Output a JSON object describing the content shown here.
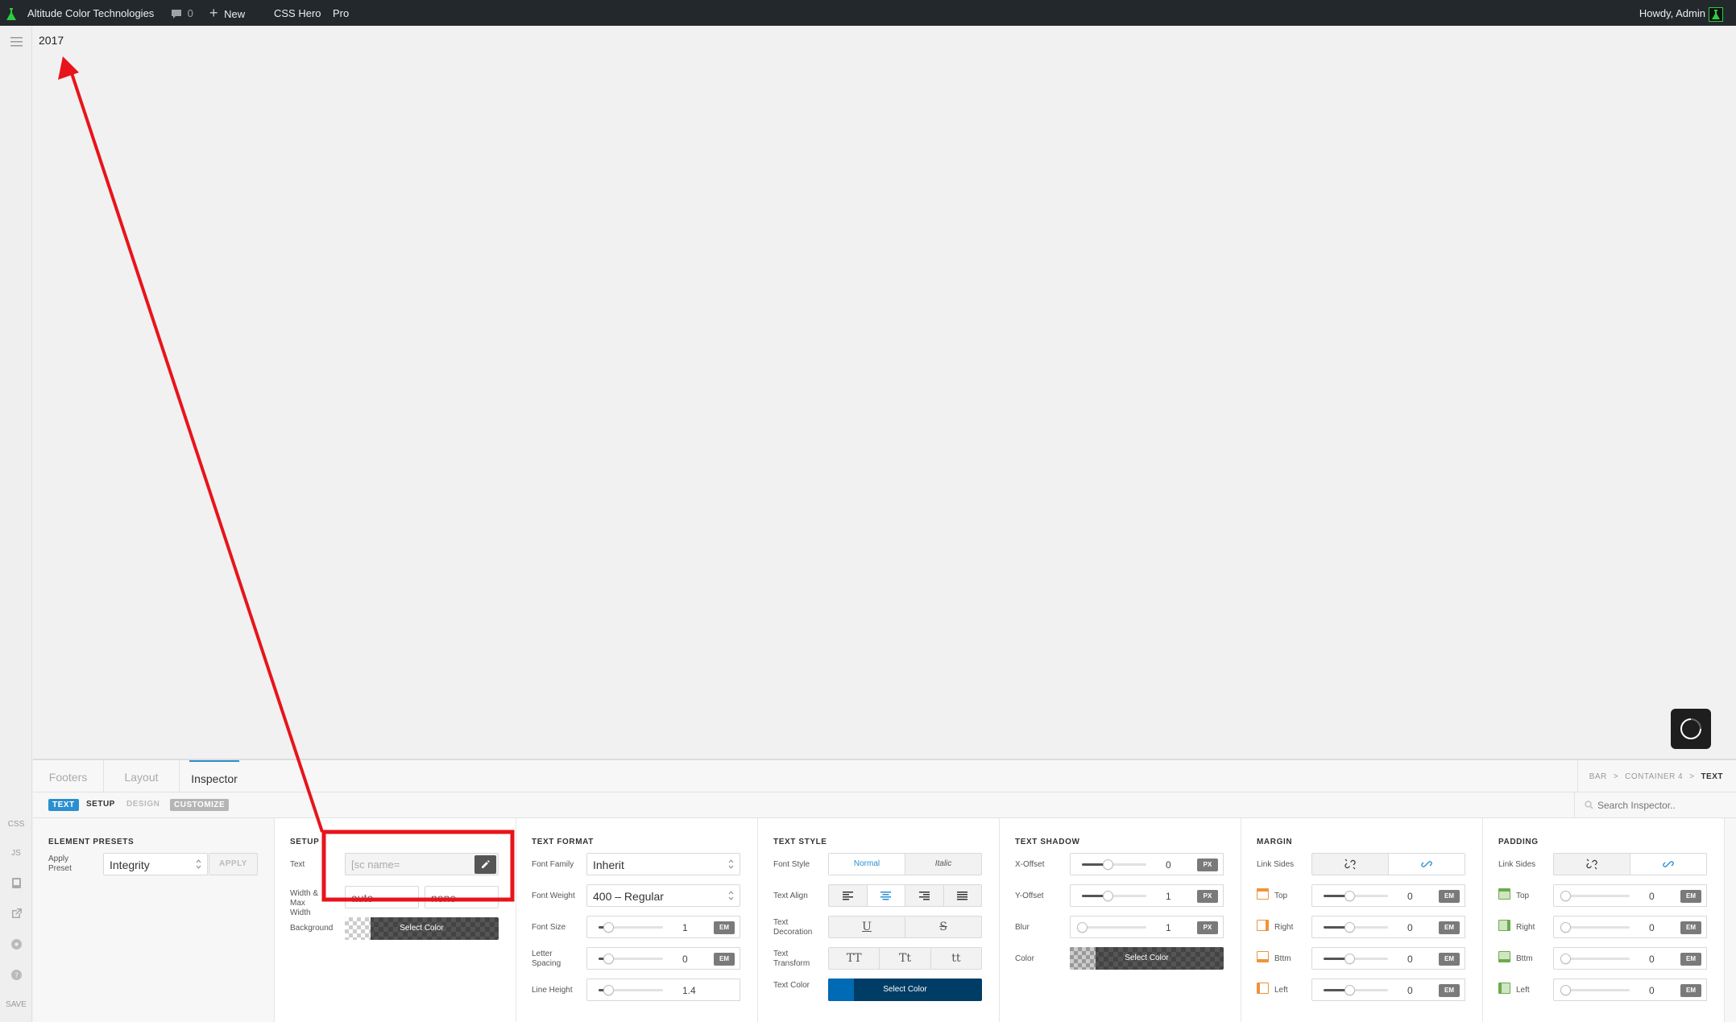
{
  "adminbar": {
    "site_name": "Altitude Color Technologies",
    "comments_count": "0",
    "new_label": "New",
    "css_hero_label": "CSS Hero",
    "pro_label": "Pro",
    "greeting": "Howdy, Admin"
  },
  "rail": {
    "css": "CSS",
    "js": "JS",
    "save": "SAVE"
  },
  "preview": {
    "text": "2017"
  },
  "tabs": {
    "footers": "Footers",
    "layout": "Layout",
    "inspector": "Inspector"
  },
  "breadcrumb": {
    "a": "BAR",
    "b": "CONTAINER 4",
    "c": "TEXT",
    "sep": ">"
  },
  "subtabs": {
    "text": "TEXT",
    "setup": "SETUP",
    "design": "DESIGN",
    "customize": "CUSTOMIZE"
  },
  "search": {
    "placeholder": "Search Inspector.."
  },
  "presets": {
    "title": "ELEMENT PRESETS",
    "apply_label": "Apply Preset",
    "value": "Integrity",
    "button": "APPLY"
  },
  "setup": {
    "title": "SETUP",
    "text_label": "Text",
    "text_placeholder": "[sc name=",
    "width_label": "Width & Max Width",
    "width_value": "auto",
    "maxwidth_value": "none",
    "background_label": "Background",
    "select_color": "Select Color"
  },
  "text_format": {
    "title": "TEXT FORMAT",
    "font_family_label": "Font Family",
    "font_family": "Inherit",
    "font_weight_label": "Font Weight",
    "font_weight": "400 – Regular",
    "font_size_label": "Font Size",
    "font_size": "1",
    "font_size_unit": "EM",
    "font_size_level": 0.15,
    "letter_spacing_label": "Letter Spacing",
    "letter_spacing": "0",
    "letter_spacing_unit": "EM",
    "letter_spacing_level": 0.15,
    "line_height_label": "Line Height",
    "line_height": "1.4",
    "line_height_level": 0.15
  },
  "text_style": {
    "title": "TEXT STYLE",
    "font_style_label": "Font Style",
    "normal": "Normal",
    "italic": "Italic",
    "text_align_label": "Text Align",
    "decoration_label": "Text Decoration",
    "underline": "U",
    "strike": "S",
    "transform_label": "Text Transform",
    "upper": "TT",
    "capitalize": "Tt",
    "lower": "tt",
    "color_label": "Text Color",
    "select_color": "Select Color",
    "color": "#003d66"
  },
  "text_shadow": {
    "title": "TEXT SHADOW",
    "x_label": "X-Offset",
    "x": "0",
    "x_unit": "PX",
    "x_level": 0.4,
    "y_label": "Y-Offset",
    "y": "1",
    "y_unit": "PX",
    "y_level": 0.4,
    "blur_label": "Blur",
    "blur": "1",
    "blur_unit": "PX",
    "blur_level": 0.0,
    "color_label": "Color",
    "select_color": "Select Color"
  },
  "margin": {
    "title": "MARGIN",
    "link_label": "Link Sides",
    "top_label": "Top",
    "right_label": "Right",
    "bottom_label": "Bttm",
    "left_label": "Left",
    "value": "0",
    "unit": "EM",
    "level": 0.4
  },
  "padding": {
    "title": "PADDING",
    "link_label": "Link Sides",
    "top_label": "Top",
    "right_label": "Right",
    "bottom_label": "Bttm",
    "left_label": "Left",
    "value": "0",
    "unit": "EM",
    "level": 0.0
  },
  "colors": {
    "accent": "#2b8fd0",
    "adminbar": "#23282d",
    "annotation": "#e8141b",
    "margin_icon": "#f0923b",
    "padding_icon": "#6cab4c"
  }
}
